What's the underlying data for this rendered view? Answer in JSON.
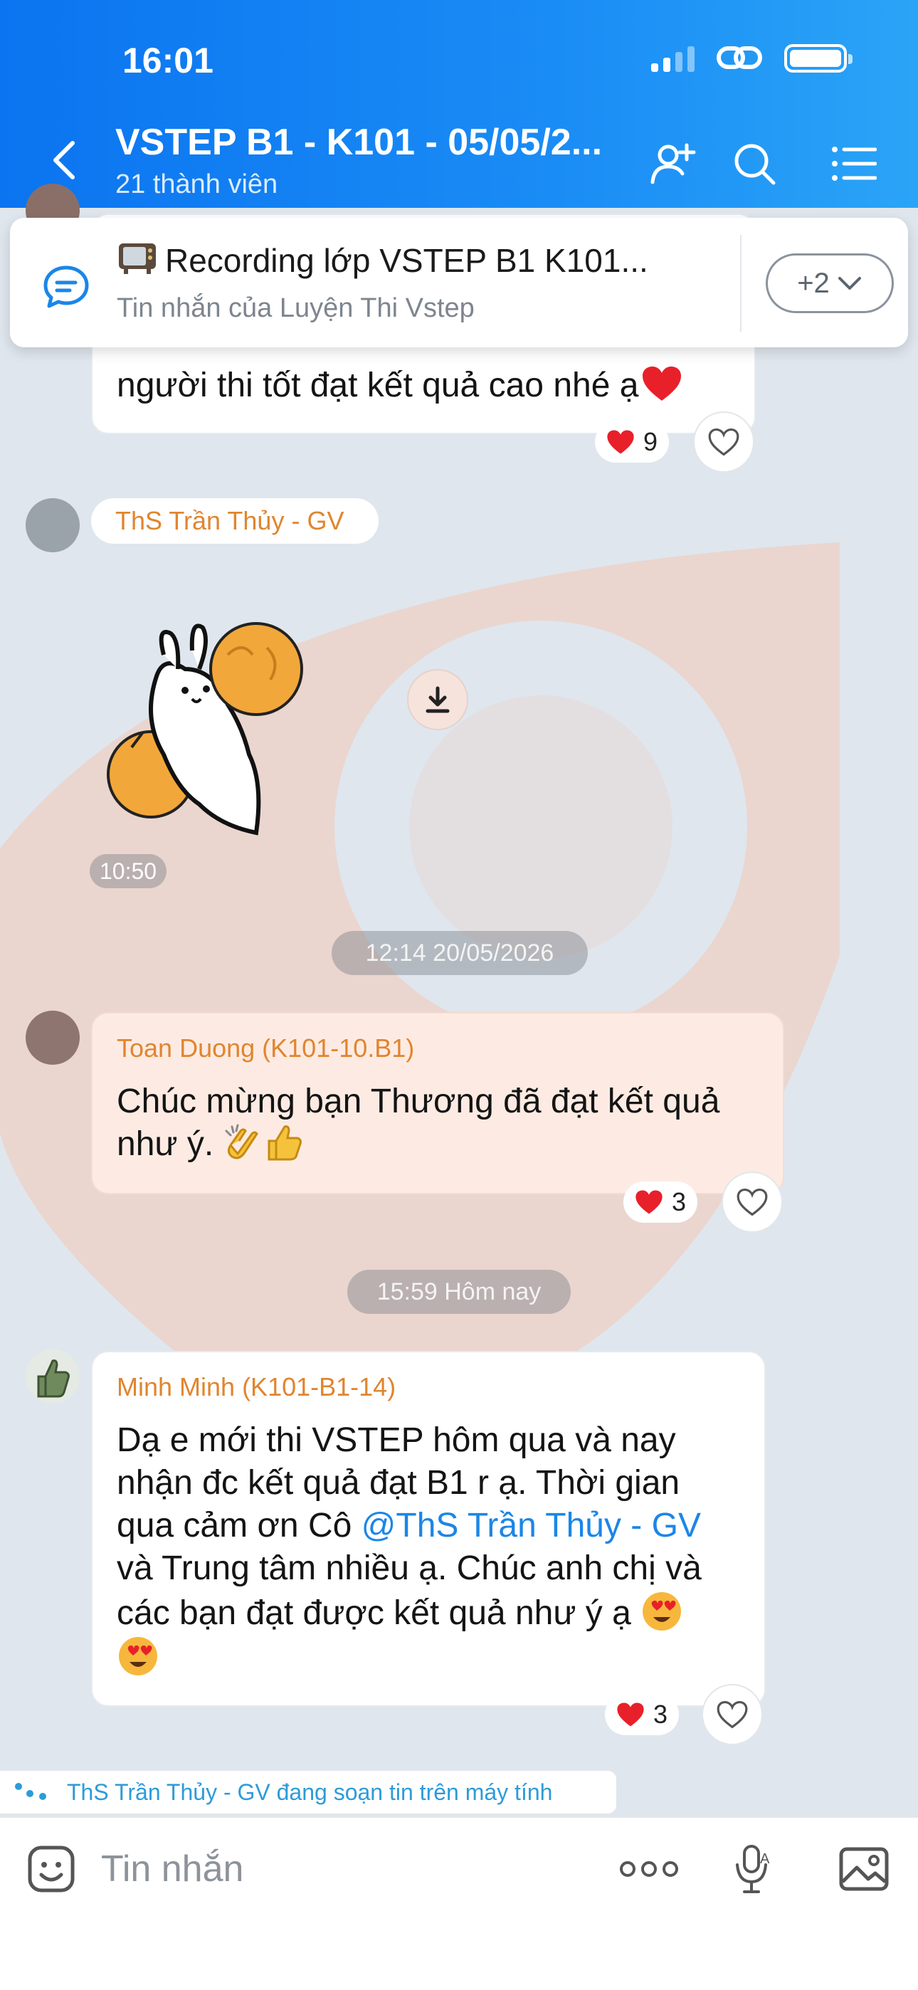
{
  "status": {
    "time": "16:01"
  },
  "header": {
    "title": "VSTEP B1 - K101 - 05/05/2...",
    "subtitle": "21 thành viên"
  },
  "pinned": {
    "title": "Recording lớp VSTEP B1 K101...",
    "sub": "Tin nhắn của Luyện Thi Vstep",
    "more": "+2"
  },
  "messages": {
    "m1": {
      "text": "người thi tốt đạt kết quả cao nhé ạ",
      "reactions": "9"
    },
    "m2": {
      "sender": "ThS Trần Thủy - GV",
      "time": "10:50"
    },
    "divider1": "12:14 20/05/2026",
    "m3": {
      "sender": "Toan Duong (K101-10.B1)",
      "line1": "Chúc mừng bạn Thương đã đạt kết quả",
      "line2": "như ý.",
      "reactions": "3"
    },
    "divider2": "15:59 Hôm nay",
    "m4": {
      "sender": "Minh Minh (K101-B1-14)",
      "line1": "Dạ e mới thi VSTEP hôm qua và nay",
      "line2": "nhận đc kết quả đạt B1 r ạ. Thời gian",
      "line3_pre": "qua cảm ơn Cô ",
      "mention": "@ThS Trần Thủy - GV",
      "line4": "và Trung tâm nhiều ạ. Chúc anh chị và",
      "line5": "các bạn đạt được kết quả như ý ạ",
      "reactions": "3"
    }
  },
  "typing": "ThS Trần Thủy - GV đang soạn tin trên máy tính",
  "input": {
    "placeholder": "Tin nhắn"
  },
  "colors": {
    "header_blue": "#0b74f0",
    "sender_orange": "#e0852f",
    "mention_blue": "#1b86e8",
    "heart_red": "#e8202a"
  }
}
